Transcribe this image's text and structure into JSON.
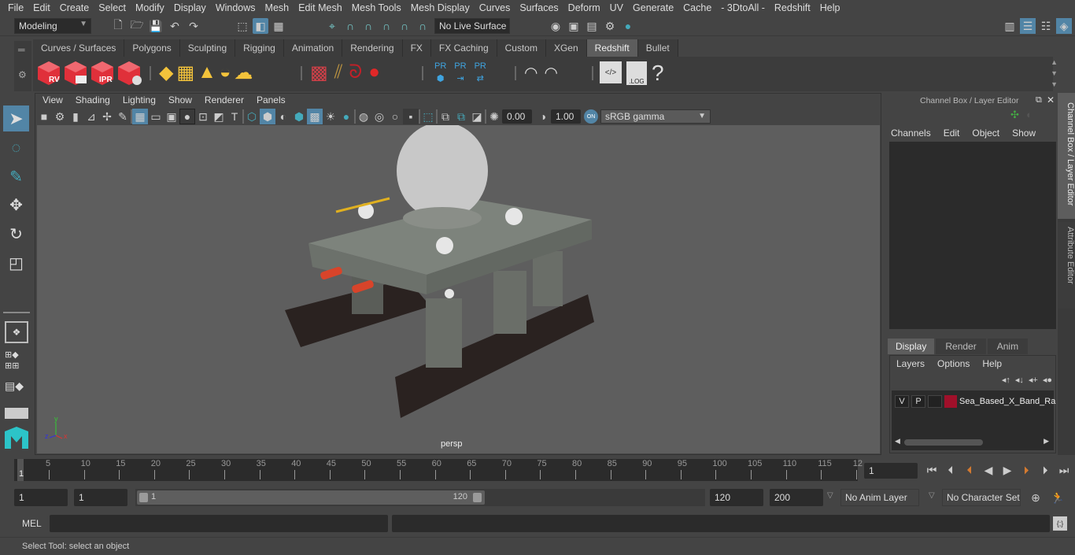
{
  "menubar": {
    "items": [
      "File",
      "Edit",
      "Create",
      "Select",
      "Modify",
      "Display",
      "Windows",
      "Mesh",
      "Edit Mesh",
      "Mesh Tools",
      "Mesh Display",
      "Curves",
      "Surfaces",
      "Deform",
      "UV",
      "Generate",
      "Cache",
      "- 3DtoAll -",
      "Redshift",
      "Help"
    ]
  },
  "statusline": {
    "workspace": "Modeling",
    "live_surface": "No Live Surface"
  },
  "shelf": {
    "tabs": [
      "Curves / Surfaces",
      "Polygons",
      "Sculpting",
      "Rigging",
      "Animation",
      "Rendering",
      "FX",
      "FX Caching",
      "Custom",
      "XGen",
      "Redshift",
      "Bullet"
    ],
    "active_tab": "Redshift",
    "icons": {
      "rv": "RV",
      "ipr": "IPR",
      "pr1": "PR",
      "pr2": "PR",
      "pr3": "PR",
      "log": ".LOG",
      "help": "?"
    }
  },
  "viewport": {
    "menu": [
      "View",
      "Shading",
      "Lighting",
      "Show",
      "Renderer",
      "Panels"
    ],
    "exposure": "0.00",
    "gamma": "1.00",
    "color_space_toggle": "ON",
    "color_space": "sRGB gamma",
    "camera_label": "persp",
    "axis": {
      "x": "x",
      "y": "y",
      "z": "z"
    }
  },
  "channel_box": {
    "title": "Channel Box / Layer Editor",
    "menu": [
      "Channels",
      "Edit",
      "Object",
      "Show"
    ],
    "layer_tabs": [
      "Display",
      "Render",
      "Anim"
    ],
    "active_layer_tab": "Display",
    "layer_menu": [
      "Layers",
      "Options",
      "Help"
    ],
    "layers": [
      {
        "v": "V",
        "p": "P",
        "color": "#a0102a",
        "name": "Sea_Based_X_Band_Ra"
      }
    ]
  },
  "side_tabs": [
    "Channel Box / Layer Editor",
    "Attribute Editor"
  ],
  "timeline": {
    "ticks": [
      "5",
      "10",
      "15",
      "20",
      "25",
      "30",
      "35",
      "40",
      "45",
      "50",
      "55",
      "60",
      "65",
      "70",
      "75",
      "80",
      "85",
      "90",
      "95",
      "100",
      "105",
      "110",
      "115",
      "12"
    ],
    "current_frame_marker": "1",
    "current_frame": "1"
  },
  "range": {
    "start": "1",
    "playback_start": "1",
    "slider_start": "1",
    "slider_end": "120",
    "playback_end": "120",
    "end": "200",
    "anim_layer": "No Anim Layer",
    "character_set": "No Character Set"
  },
  "command": {
    "label": "MEL"
  },
  "help_line": "Select Tool: select an object",
  "colors": {
    "accent": "#5285a6",
    "redshift_red": "#e0303a",
    "key_orange": "#d47a30",
    "layer_color": "#a0102a"
  }
}
